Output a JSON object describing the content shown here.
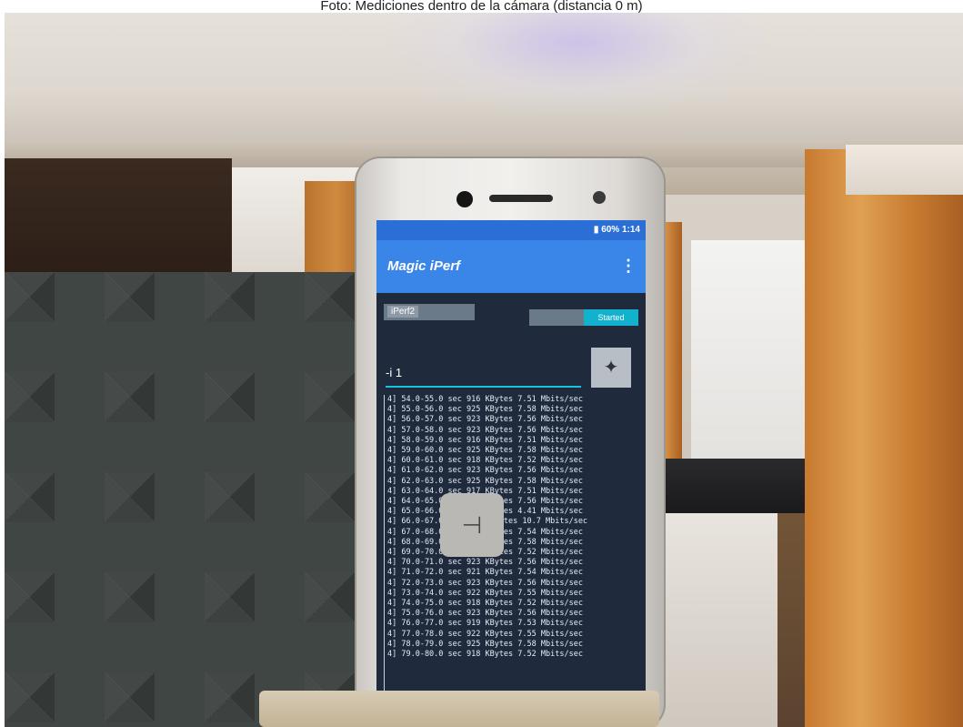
{
  "caption": "Foto: Mediciones dentro de la cámara (distancia 0 m)",
  "phone_ui": {
    "status_text": "60% 1:14",
    "app_title": "Magic iPerf",
    "menu_icon": "more-vert-icon",
    "tab_label": "iPerf2",
    "started_label": "Started",
    "command_text": "-i 1",
    "app_icon": "magic-iperf-icon",
    "overlay_icon": "transfer-icon",
    "log_rows": [
      "4] 54.0-55.0 sec  916 KBytes  7.51 Mbits/sec",
      "4] 55.0-56.0 sec  925 KBytes  7.58 Mbits/sec",
      "4] 56.0-57.0 sec  923 KBytes  7.56 Mbits/sec",
      "4] 57.0-58.0 sec  923 KBytes  7.56 Mbits/sec",
      "4] 58.0-59.0 sec  916 KBytes  7.51 Mbits/sec",
      "4] 59.0-60.0 sec  925 KBytes  7.58 Mbits/sec",
      "4] 60.0-61.0 sec  918 KBytes  7.52 Mbits/sec",
      "4] 61.0-62.0 sec  923 KBytes  7.56 Mbits/sec",
      "4] 62.0-63.0 sec  925 KBytes  7.58 Mbits/sec",
      "4] 63.0-64.0 sec  917 KBytes  7.51 Mbits/sec",
      "4] 64.0-65.0 sec  923 KBytes  7.56 Mbits/sec",
      "4] 65.0-66.0 sec  538 KBytes  4.41 Mbits/sec",
      "4] 66.0-67.0 sec  1.27 MBytes  10.7 Mbits/sec",
      "4] 67.0-68.0 sec  921 KBytes  7.54 Mbits/sec",
      "4] 68.0-69.0 sec  925 KBytes  7.58 Mbits/sec",
      "4] 69.0-70.0 sec  918 KBytes  7.52 Mbits/sec",
      "4] 70.0-71.0 sec  923 KBytes  7.56 Mbits/sec",
      "4] 71.0-72.0 sec  921 KBytes  7.54 Mbits/sec",
      "4] 72.0-73.0 sec  923 KBytes  7.56 Mbits/sec",
      "4] 73.0-74.0 sec  922 KBytes  7.55 Mbits/sec",
      "4] 74.0-75.0 sec  918 KBytes  7.52 Mbits/sec",
      "4] 75.0-76.0 sec  923 KBytes  7.56 Mbits/sec",
      "4] 76.0-77.0 sec  919 KBytes  7.53 Mbits/sec",
      "4] 77.0-78.0 sec  922 KBytes  7.55 Mbits/sec",
      "4] 78.0-79.0 sec  925 KBytes  7.58 Mbits/sec",
      "4] 79.0-80.0 sec  918 KBytes  7.52 Mbits/sec"
    ]
  }
}
